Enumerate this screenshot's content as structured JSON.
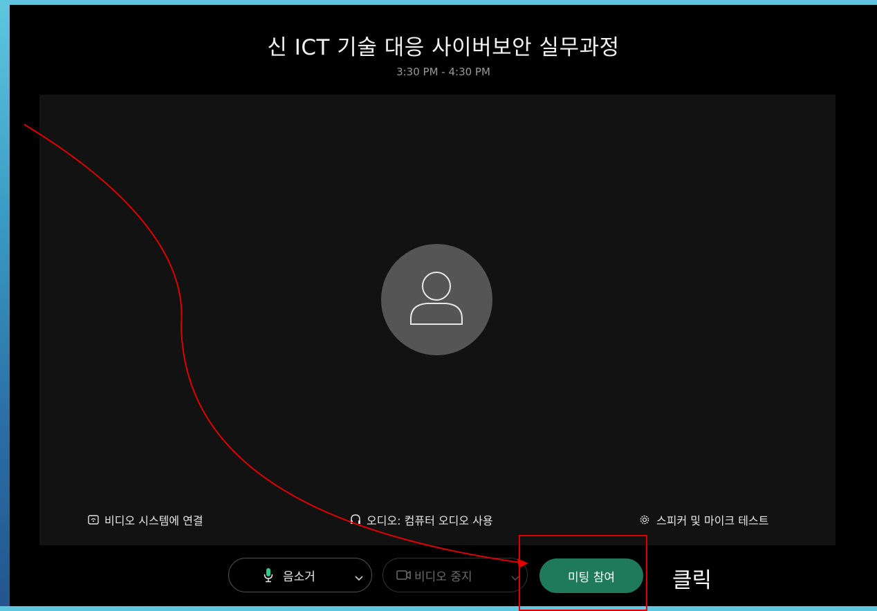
{
  "meeting": {
    "title": "신 ICT 기술 대응 사이버보안 실무과정",
    "time": "3:30 PM - 4:30 PM"
  },
  "options": {
    "video_system": "비디오 시스템에 연결",
    "audio": "오디오: 컴퓨터 오디오 사용",
    "test": "스피커 및 마이크 테스트"
  },
  "controls": {
    "mute_label": "음소거",
    "video_label": "비디오 중지",
    "join_label": "미팅 참여"
  },
  "annotation": {
    "click_label": "클릭",
    "color": "#e00000"
  },
  "colors": {
    "join_button": "#1f7a5c",
    "mic_active": "#2ecc8a",
    "background": "#000000"
  }
}
